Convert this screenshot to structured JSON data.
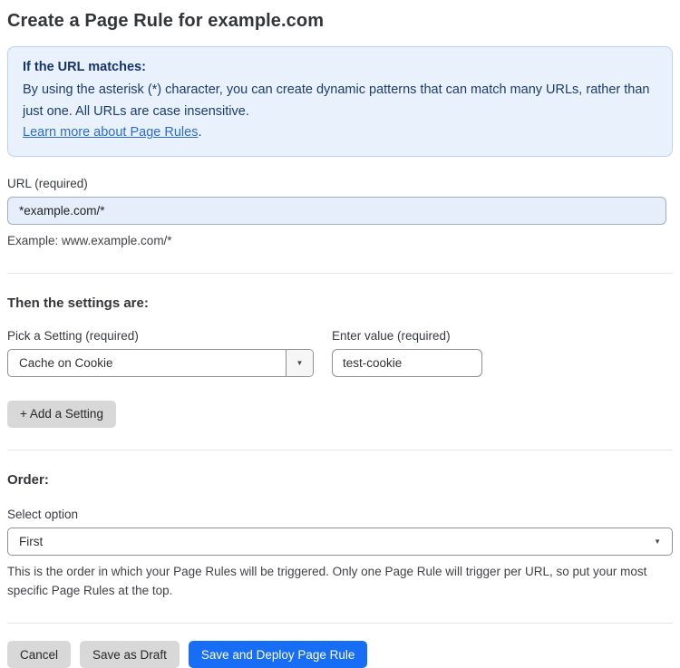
{
  "page": {
    "title": "Create a Page Rule for example.com"
  },
  "info_box": {
    "heading": "If the URL matches:",
    "body": "By using the asterisk (*) character, you can create dynamic patterns that can match many URLs, rather than just one. All URLs are case insensitive.",
    "link_label": "Learn more about Page Rules",
    "link_suffix": "."
  },
  "url_field": {
    "label": "URL (required)",
    "value": "*example.com/*",
    "example": "Example: www.example.com/*"
  },
  "settings": {
    "heading": "Then the settings are:",
    "setting_label": "Pick a Setting (required)",
    "setting_value": "Cache on Cookie",
    "value_label": "Enter value (required)",
    "value_value": "test-cookie",
    "add_button_label": "+ Add a Setting"
  },
  "order": {
    "heading": "Order:",
    "select_label": "Select option",
    "select_value": "First",
    "help": "This is the order in which your Page Rules will be triggered. Only one Page Rule will trigger per URL, so put your most specific Page Rules at the top."
  },
  "footer": {
    "cancel_label": "Cancel",
    "save_draft_label": "Save as Draft",
    "save_deploy_label": "Save and Deploy Page Rule"
  },
  "icons": {
    "dropdown_caret": "▼"
  },
  "colors": {
    "accent_blue": "#176df4",
    "info_box_bg": "#e9f2fc",
    "info_box_border": "#bad4ee",
    "info_text": "#1b3c6e",
    "link_blue": "#2b6cd4",
    "url_input_bg": "#e7eefb",
    "button_gray": "#d8d8d8"
  }
}
